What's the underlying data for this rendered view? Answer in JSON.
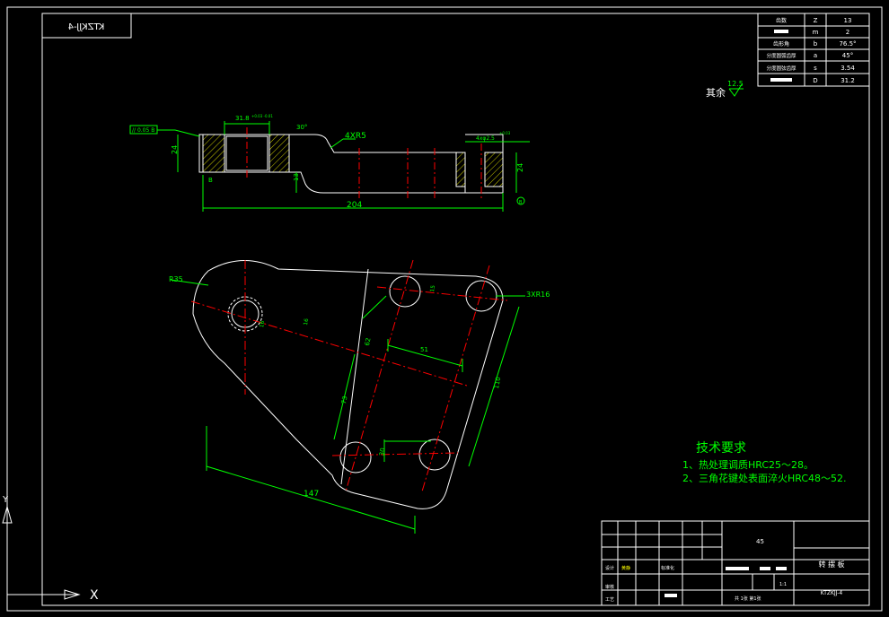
{
  "drawing_code_mirrored": "KTZKJJ-4",
  "params_table": {
    "rows": [
      {
        "name": "齿数",
        "symbol": "Z",
        "value": "13"
      },
      {
        "name": "",
        "symbol": "m",
        "value": "2"
      },
      {
        "name": "齿形角",
        "symbol": "b",
        "value": "76.5°"
      },
      {
        "name": "分度圆弧齿厚",
        "symbol": "a",
        "value": "45°"
      },
      {
        "name": "分度圆弦齿厚",
        "symbol": "s",
        "value": "3.54"
      },
      {
        "name": "",
        "symbol": "D",
        "value": "31.2"
      }
    ]
  },
  "surface_finish": {
    "label": "其余",
    "value": "12.5"
  },
  "top_view": {
    "tolerance_frame": "// 0.05 B",
    "dim_width": "31.8",
    "dim_width_tol": "+0.03\n-0.01",
    "dim_30deg": "30°",
    "dim_4xr5": "4XR5",
    "dim_height_left": "24",
    "dim_13": "13",
    "dim_bottom_left": "B",
    "dim_total": "204",
    "dim_height_right": "24",
    "dim_groove": "4xφ2.5",
    "dim_groove_tol": "+0.03",
    "datum_right": "B"
  },
  "front_view": {
    "dim_r35": "R35",
    "dim_3xr16": "3XR16",
    "dim_16": "16",
    "dim_62": "62",
    "dim_51": "51",
    "dim_73": "73",
    "dim_110": "110",
    "dim_147": "147",
    "dim_30": "30",
    "dim_15": "15",
    "dim_16b": "16"
  },
  "tech_req": {
    "title": "技术要求",
    "line1": "1、热处理调质HRC25～28。",
    "line2": "2、三角花键处表面淬火HRC48～52."
  },
  "title_block": {
    "material": "45",
    "part_name": "转  摆  板",
    "scale": "1:1",
    "drawing_no": "KTZKJJ-4",
    "sheet_info": "共 1张  第1张",
    "label_design": "设计",
    "label_std": "标准化",
    "label_review": "审核",
    "label_process": "工艺",
    "designer": "黄静"
  },
  "colors": {
    "outline": "#ffffff",
    "dimension": "#00ff00",
    "center": "#ff0000",
    "hatch": "#ffff00",
    "text": "#ffffff"
  }
}
